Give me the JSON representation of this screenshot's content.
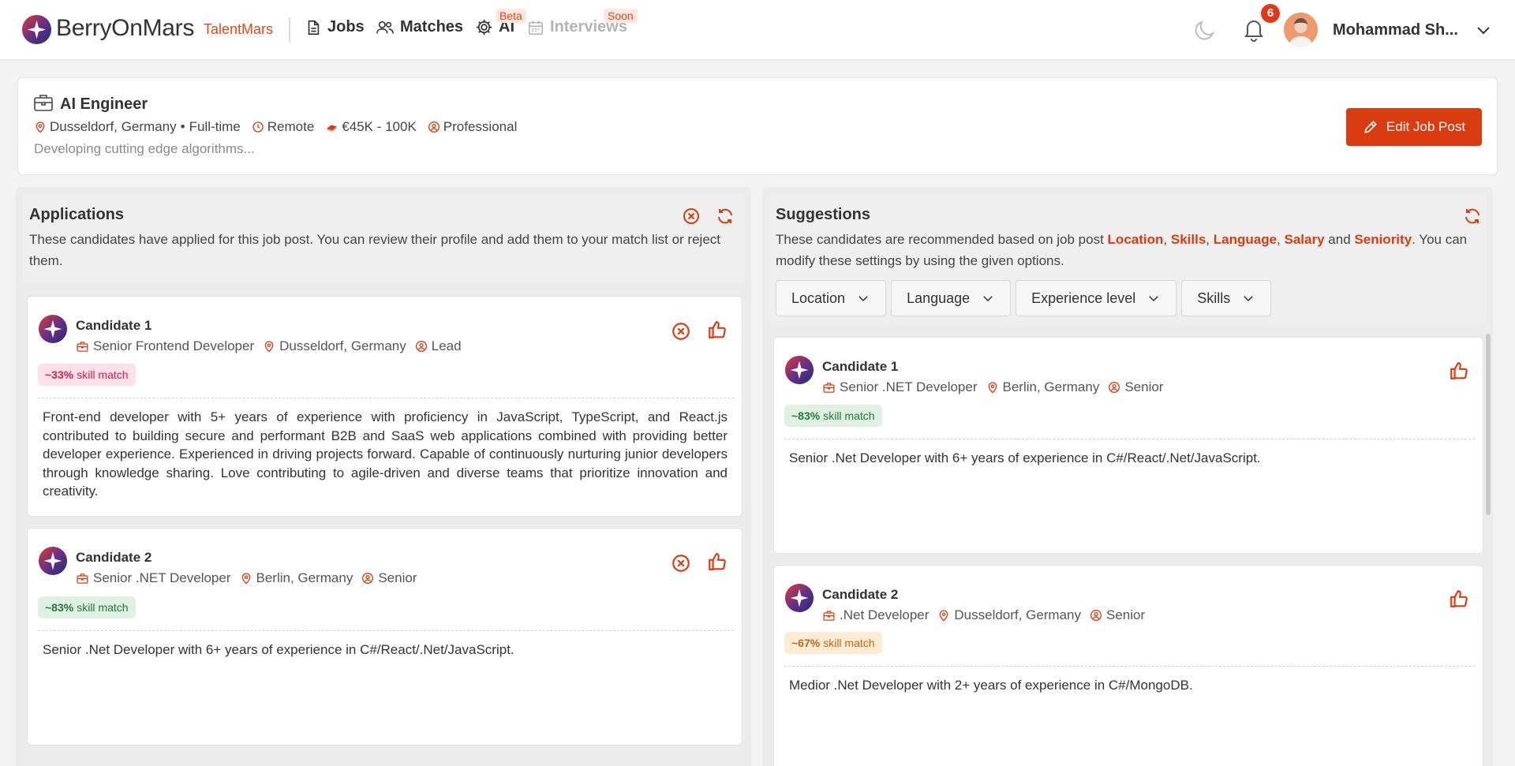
{
  "header": {
    "brand": "BerryOnMars",
    "sub_brand": "TalentMars",
    "nav": [
      {
        "label": "Jobs",
        "icon": "document-icon"
      },
      {
        "label": "Matches",
        "icon": "users-icon"
      },
      {
        "label": "AI",
        "icon": "gear-icon",
        "badge": "Beta"
      },
      {
        "label": "Interviews",
        "icon": "calendar-icon",
        "badge": "Soon",
        "disabled": true
      }
    ],
    "notifications_count": "6",
    "user_name": "Mohammad Sh..."
  },
  "job": {
    "title": "AI Engineer",
    "location": "Dusseldorf, Germany",
    "separator": "•",
    "type": "Full-time",
    "work_mode": "Remote",
    "salary": "€45K - 100K",
    "level": "Professional",
    "description": "Developing cutting edge algorithms...",
    "edit_label": "Edit Job Post"
  },
  "applications": {
    "title": "Applications",
    "description": "These candidates have applied for this job post. You can review their profile and add them to your match list or reject them.",
    "candidates": [
      {
        "name": "Candidate 1",
        "role": "Senior Frontend Developer",
        "location": "Dusseldorf, Germany",
        "seniority": "Lead",
        "match_value": "~33%",
        "match_label": "skill match",
        "summary": "Front-end developer with 5+ years of experience with proficiency in JavaScript, TypeScript, and React.js contributed to building secure and performant B2B and SaaS web applications combined with providing better developer experience. Experienced in driving projects forward. Capable of continuously nurturing junior developers through knowledge sharing. Love contributing to agile-driven and diverse teams that prioritize innovation and creativity."
      },
      {
        "name": "Candidate 2",
        "role": "Senior .NET Developer",
        "location": "Berlin, Germany",
        "seniority": "Senior",
        "match_value": "~83%",
        "match_label": "skill match",
        "summary": "Senior .Net Developer with 6+ years of experience in C#/React/.Net/JavaScript."
      }
    ]
  },
  "suggestions": {
    "title": "Suggestions",
    "desc_prefix": "These candidates are recommended based on job post ",
    "desc_location": "Location",
    "desc_comma": ",",
    "desc_skills": "Skills",
    "desc_language": "Language",
    "desc_salary": "Salary",
    "desc_and": "and",
    "desc_seniority": "Seniority",
    "desc_suffix": ". You can modify these settings by using the given options.",
    "filters": [
      "Location",
      "Language",
      "Experience level",
      "Skills"
    ],
    "candidates": [
      {
        "name": "Candidate 1",
        "role": "Senior .NET Developer",
        "location": "Berlin, Germany",
        "seniority": "Senior",
        "match_value": "~83%",
        "match_label": "skill match",
        "summary": "Senior .Net Developer with 6+ years of experience in C#/React/.Net/JavaScript."
      },
      {
        "name": "Candidate 2",
        "role": ".Net Developer",
        "location": "Dusseldorf, Germany",
        "seniority": "Senior",
        "match_value": "~67%",
        "match_label": "skill match",
        "summary": "Medior .Net Developer with 2+ years of experience in C#/MongoDB."
      }
    ]
  },
  "colors": {
    "accent": "#d93c10",
    "match_red": "#c8224d",
    "match_green": "#22783c",
    "match_orange": "#b86b13"
  }
}
